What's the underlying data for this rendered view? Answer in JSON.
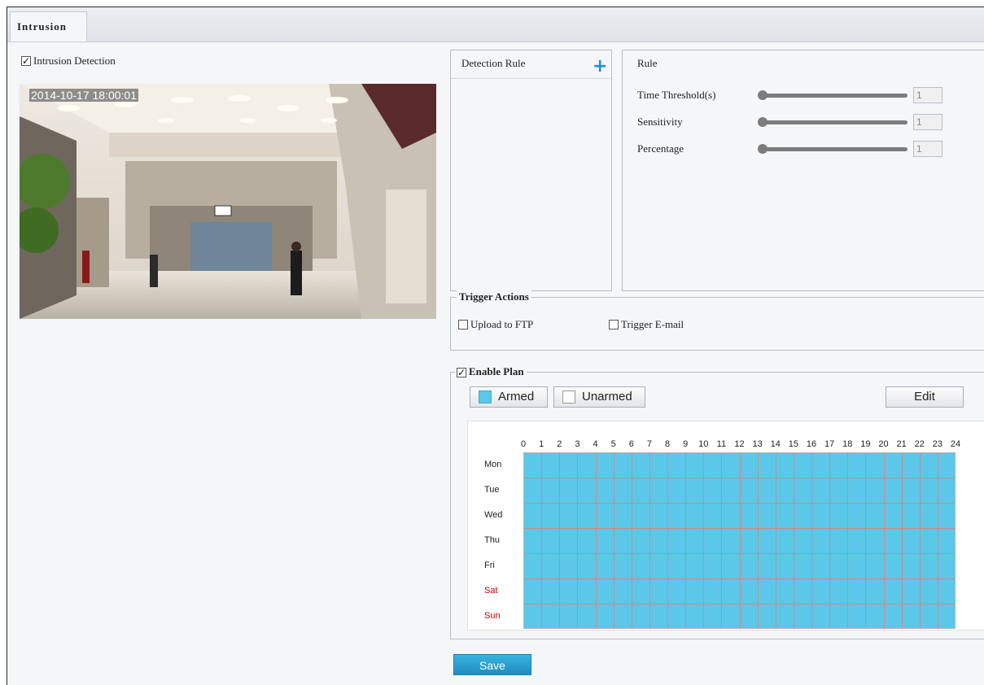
{
  "tab": {
    "label": "Intrusion"
  },
  "intrusion_detection": {
    "label": "Intrusion Detection",
    "checked": true
  },
  "video": {
    "timestamp": "2014-10-17 18:00:01"
  },
  "detection_rule": {
    "header": "Detection Rule"
  },
  "rule": {
    "title": "Rule",
    "params": [
      {
        "label": "Time Threshold(s)",
        "value": "1"
      },
      {
        "label": "Sensitivity",
        "value": "1"
      },
      {
        "label": "Percentage",
        "value": "1"
      }
    ]
  },
  "trigger_actions": {
    "title": "Trigger Actions",
    "options": [
      {
        "label": "Upload to FTP",
        "checked": false
      },
      {
        "label": "Trigger E-mail",
        "checked": false
      }
    ]
  },
  "plan": {
    "title": "Enable Plan",
    "checked": true,
    "armed_label": "Armed",
    "unarmed_label": "Unarmed",
    "edit_label": "Edit",
    "armed_color": "#5bc8e9",
    "weekend_color": "#cc0000",
    "hours": [
      "0",
      "1",
      "2",
      "3",
      "4",
      "5",
      "6",
      "7",
      "8",
      "9",
      "10",
      "11",
      "12",
      "13",
      "14",
      "15",
      "16",
      "17",
      "18",
      "19",
      "20",
      "21",
      "22",
      "23",
      "24"
    ],
    "days": [
      "Mon",
      "Tue",
      "Wed",
      "Thu",
      "Fri",
      "Sat",
      "Sun"
    ]
  },
  "save_label": "Save"
}
